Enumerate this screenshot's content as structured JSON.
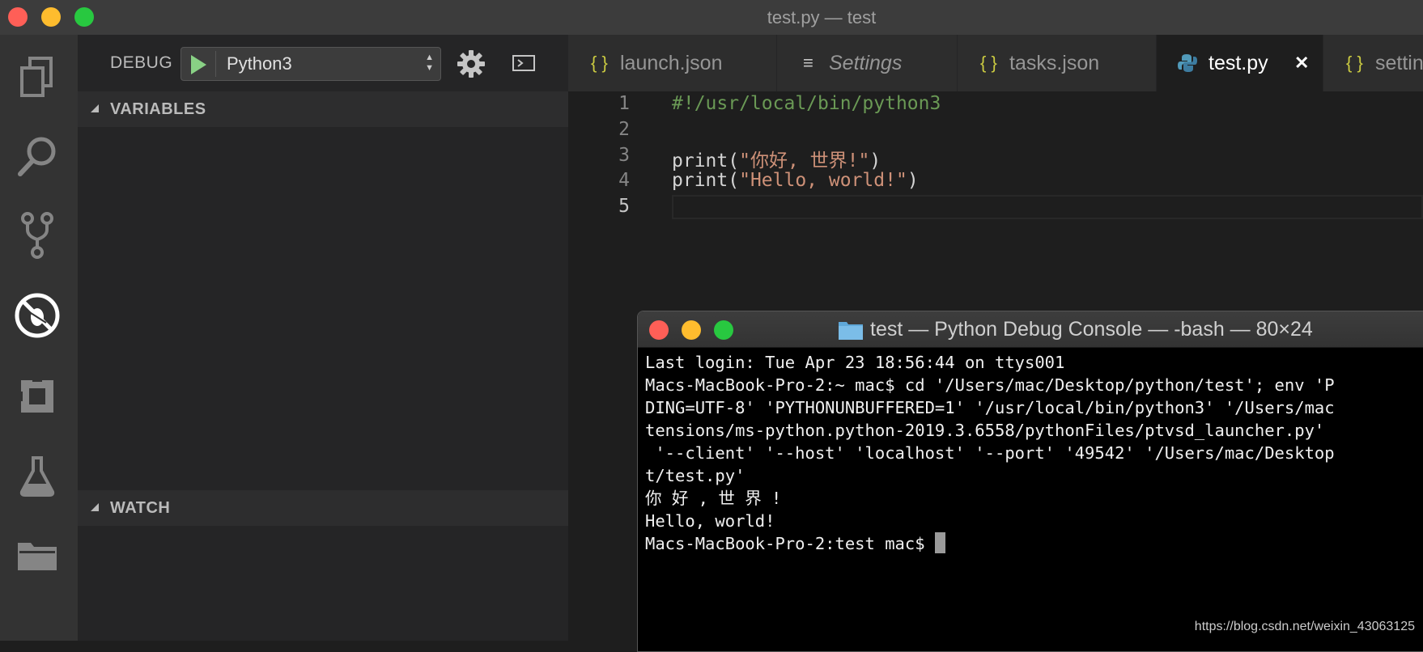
{
  "window": {
    "title": "test.py — test"
  },
  "debug": {
    "label": "DEBUG",
    "configuration": "Python3"
  },
  "sections": {
    "variables": "VARIABLES",
    "watch": "WATCH"
  },
  "tabs": [
    {
      "label": "launch.json",
      "icon": "{ }"
    },
    {
      "label": "Settings",
      "icon": "≡"
    },
    {
      "label": "tasks.json",
      "icon": "{ }"
    },
    {
      "label": "test.py",
      "close": "✕"
    },
    {
      "label": "settin",
      "icon": "{ }"
    }
  ],
  "editor": {
    "line_numbers": [
      "1",
      "2",
      "3",
      "4",
      "5"
    ],
    "lines": [
      {
        "comment": "#!/usr/local/bin/python3"
      },
      {},
      {
        "fn": "print(",
        "str": "\"你好, 世界!\"",
        "end": ")"
      },
      {
        "fn": "print(",
        "str": "\"Hello, world!\"",
        "end": ")"
      },
      {}
    ]
  },
  "terminal": {
    "title": "test — Python Debug Console — -bash — 80×24",
    "lines": [
      "Last login: Tue Apr 23 18:56:44 on ttys001",
      "Macs-MacBook-Pro-2:~ mac$ cd '/Users/mac/Desktop/python/test'; env 'P",
      "DING=UTF-8' 'PYTHONUNBUFFERED=1' '/usr/local/bin/python3' '/Users/mac",
      "tensions/ms-python.python-2019.3.6558/pythonFiles/ptvsd_launcher.py'",
      " '--client' '--host' 'localhost' '--port' '49542' '/Users/mac/Desktop",
      "t/test.py'",
      "你 好 , 世 界 !",
      "Hello, world!"
    ],
    "prompt": "Macs-MacBook-Pro-2:test mac$ "
  },
  "watermark": "https://blog.csdn.net/weixin_43063125",
  "colors": {
    "accent_play": "#89d185",
    "json_icon": "#cbcb41",
    "python_icon": "#519aba",
    "comment": "#6a9955",
    "string": "#ce9178"
  }
}
